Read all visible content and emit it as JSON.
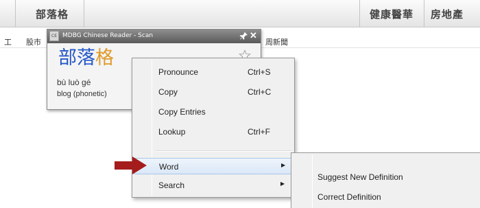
{
  "page_tabs": {
    "left": "部落格",
    "right1": "健康醫華",
    "right2": "房地產"
  },
  "nav_row": {
    "left_fragment": "工",
    "stock": "股市",
    "news_fragment": "周新聞"
  },
  "popup": {
    "logo_text": "CE",
    "title": "MDBG Chinese Reader - Scan",
    "hanzi_part1": "部落",
    "hanzi_part2": "格",
    "pinyin": "bù luò gé",
    "gloss": "blog (phonetic)",
    "icons": {
      "pin": "pin-icon",
      "close": "close-icon",
      "star": "star-icon"
    },
    "colors": {
      "hanzi_blue": "#2457c6",
      "hanzi_orange": "#e09a2a"
    }
  },
  "context_menu": {
    "items": [
      {
        "label": "Pronounce",
        "shortcut": "Ctrl+S"
      },
      {
        "label": "Copy",
        "shortcut": "Ctrl+C"
      },
      {
        "label": "Copy Entries",
        "shortcut": ""
      },
      {
        "label": "Lookup",
        "shortcut": "Ctrl+F"
      }
    ],
    "submenu_items": [
      {
        "label": "Word",
        "highlighted": true
      },
      {
        "label": "Search",
        "highlighted": false
      }
    ]
  },
  "word_submenu": {
    "items": [
      {
        "label": "Suggest New Definition"
      },
      {
        "label": "Correct Definition"
      }
    ]
  },
  "annotation": {
    "pointer_color": "#a51c1c",
    "pointer_icon": "red-arrow-icon"
  }
}
